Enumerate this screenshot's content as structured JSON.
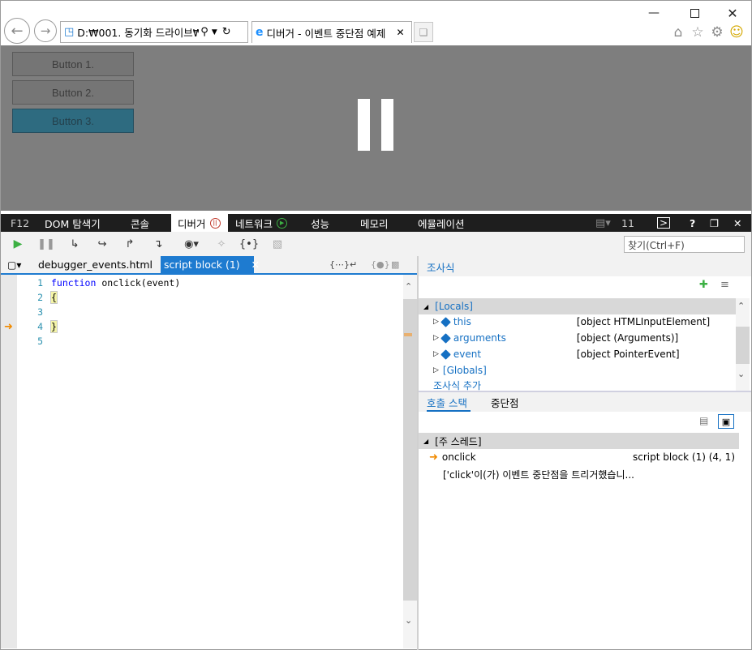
{
  "browser": {
    "address": "D:₩001. 동기화 드라이브₩C",
    "tab_title": "디버거 - 이벤트 중단점 예제",
    "window_controls": [
      "minimize-icon",
      "maximize-icon",
      "close-icon"
    ]
  },
  "page": {
    "buttons": [
      "Button 1.",
      "Button 2.",
      "Button 3."
    ],
    "paused_overlay": "pause-icon"
  },
  "devtools": {
    "f12_label": "F12",
    "tabs": [
      "DOM 탐색기",
      "콘솔",
      "디버거",
      "네트워크",
      "성능",
      "메모리",
      "에뮬레이션"
    ],
    "active_tab": "디버거",
    "screen_count": "11",
    "find_placeholder": "찾기(Ctrl+F)",
    "file_tabs": [
      "debugger_events.html",
      "script block (1)"
    ],
    "active_file_tab": "script block (1)",
    "code": {
      "lines": [
        "1",
        "2",
        "3",
        "4",
        "5"
      ],
      "line1_keyword": "function",
      "line1_rest": " onclick(event)",
      "line2": "{",
      "line4": "}"
    },
    "watch": {
      "title": "조사식",
      "locals_label": "[Locals]",
      "items": [
        {
          "name": "this",
          "value": "[object HTMLInputElement]"
        },
        {
          "name": "arguments",
          "value": "[object (Arguments)]"
        },
        {
          "name": "event",
          "value": "[object PointerEvent]"
        }
      ],
      "globals_label": "[Globals]",
      "add_watch": "조사식 추가"
    },
    "callstack": {
      "tab_callstack": "호출 스택",
      "tab_breakpoints": "중단점",
      "thread_label": "[주 스레드]",
      "frame_name": "onclick",
      "frame_location": "script block (1) (4, 1)",
      "frame_note": "['click'이(가) 이벤트 중단점을 트리거했습니..."
    }
  }
}
